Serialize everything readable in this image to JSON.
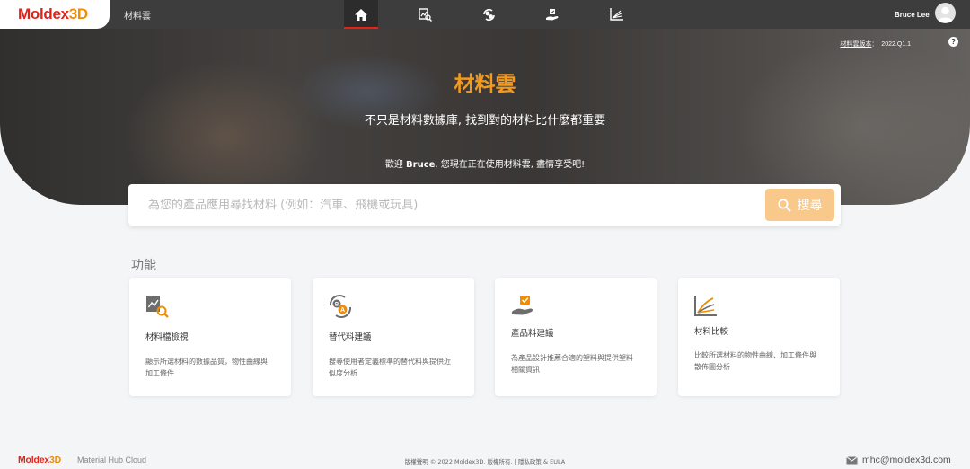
{
  "header": {
    "logo_main": "Moldex",
    "logo_accent": "3D",
    "app_name": "材料雲",
    "nav_items": [
      {
        "icon": "home-icon",
        "active": true
      },
      {
        "icon": "material-search-icon",
        "active": false
      },
      {
        "icon": "replacement-icon",
        "active": false
      },
      {
        "icon": "hand-recommend-icon",
        "active": false
      },
      {
        "icon": "chart-compare-icon",
        "active": false
      }
    ],
    "user_name": "Bruce Lee"
  },
  "hero": {
    "version_label": "材料雲版本",
    "version_sep": "：",
    "version_value": "2022.Q1.1",
    "help": "?",
    "title": "材料雲",
    "subtitle": "不只是材料數據庫, 找到對的材料比什麼都重要",
    "welcome_prefix": "歡迎 ",
    "welcome_user": "Bruce",
    "welcome_suffix": ", 您現在正在使用材料雲, 盡情享受吧!"
  },
  "search": {
    "placeholder": "為您的產品應用尋找材料 (例如：汽車、飛機或玩具)",
    "value": "",
    "button_label": "搜尋"
  },
  "features": {
    "section_title": "功能",
    "cards": [
      {
        "icon": "material-inspect-icon",
        "title": "材料檔檢視",
        "desc": "顯示所選材料的數據品質，物性曲線與加工條件"
      },
      {
        "icon": "substitute-material-icon",
        "title": "替代料建議",
        "desc": "搜尋使用者定義標準的替代料與提供近似度分析"
      },
      {
        "icon": "product-material-icon",
        "title": "產品料建議",
        "desc": "為產品設計推薦合適的塑料與提供塑料相關資訊"
      },
      {
        "icon": "material-compare-icon",
        "title": "材料比較",
        "desc": "比較所選材料的物性曲線、加工條件與散佈圖分析"
      }
    ]
  },
  "footer": {
    "logo_main": "Moldex",
    "logo_accent": "3D",
    "subtitle": "Material Hub Cloud",
    "copyright": "版權聲明 © 2022 Moldex3D. 版權所有. | 隱私政策 & EULA",
    "email": "mhc@moldex3d.com"
  },
  "colors": {
    "brand_red": "#e2231a",
    "brand_orange": "#f29a1f",
    "search_button": "#f9c98c",
    "topbar": "#3d3d3d"
  }
}
